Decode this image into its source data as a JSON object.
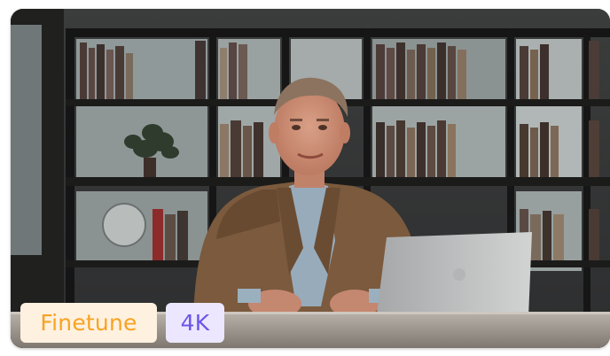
{
  "video_card": {
    "thumbnail_icon": "presenter-video-thumbnail",
    "badges": {
      "finetune": {
        "label": "Finetune",
        "text_color": "#f7a323",
        "bg_color": "#fff1df"
      },
      "resolution": {
        "label": "4K",
        "text_color": "#6c55e8",
        "bg_color": "#ece7ff"
      }
    }
  }
}
